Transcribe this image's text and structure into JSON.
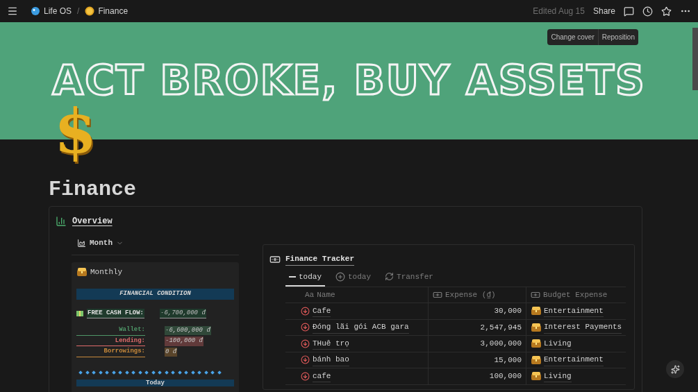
{
  "topbar": {
    "breadcrumbs": [
      {
        "label": "Life OS",
        "kind": "workspace"
      },
      {
        "label": "Finance",
        "kind": "page"
      }
    ],
    "separator": "/",
    "edited": "Edited Aug 15",
    "share": "Share"
  },
  "cover": {
    "headline": "ACT BROKE, BUY ASSETS",
    "buttons": [
      "Change cover",
      "Reposition"
    ]
  },
  "page_icon": "$",
  "page_title": "Finance",
  "overview": {
    "heading": "Overview",
    "view_tab": "Month",
    "monthly": {
      "title": "Monthly",
      "condition_header": "FINANCIAL CONDITION",
      "free_cash_flow": {
        "label": "FREE CASH FLOW:",
        "value": "-6,700,000 đ"
      },
      "lines": [
        {
          "label": "Wallet:",
          "value": "-6,600,000 đ",
          "color": "#4f9768"
        },
        {
          "label": "Lending:",
          "value": "-100,000 đ",
          "color": "#e06c6c"
        },
        {
          "label": "Borrowings:",
          "value": "0 đ",
          "color": "#c98a3b"
        }
      ],
      "today_header": "Today"
    }
  },
  "tracker": {
    "title": "Finance Tracker",
    "tabs": [
      {
        "label": "today",
        "kind": "minus",
        "selected": true
      },
      {
        "label": "today",
        "kind": "plus",
        "selected": false
      },
      {
        "label": "Transfer",
        "kind": "transfer",
        "selected": false
      }
    ],
    "columns": [
      {
        "label": "Name",
        "prefix": "Aa",
        "kind": "title"
      },
      {
        "label": "Expense (₫)",
        "kind": "money"
      },
      {
        "label": "Budget Expense",
        "kind": "relation"
      }
    ],
    "rows": [
      {
        "name": "Cafe",
        "expense": "30,000",
        "budget": "Entertainment"
      },
      {
        "name": "Đóng lãi gói ACB gara",
        "expense": "2,547,945",
        "budget": "Interest Payments"
      },
      {
        "name": "THuê trọ",
        "expense": "3,000,000",
        "budget": "Living"
      },
      {
        "name": "bánh bao",
        "expense": "15,000",
        "budget": "Entertainment"
      },
      {
        "name": "cafe",
        "expense": "100,000",
        "budget": "Living"
      }
    ]
  }
}
